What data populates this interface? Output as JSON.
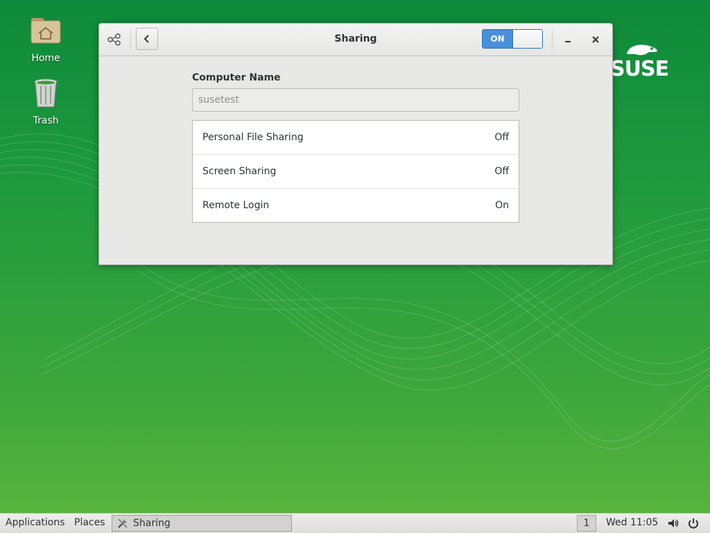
{
  "desktop": {
    "icons": [
      {
        "label": "Home",
        "icon": "home-folder-icon"
      },
      {
        "label": "Trash",
        "icon": "trash-icon"
      }
    ],
    "brand": "SUSE"
  },
  "window": {
    "title": "Sharing",
    "toggle_label": "ON",
    "computer_name": {
      "label": "Computer Name",
      "value": "susetest"
    },
    "services": [
      {
        "name": "Personal File Sharing",
        "status": "Off"
      },
      {
        "name": "Screen Sharing",
        "status": "Off"
      },
      {
        "name": "Remote Login",
        "status": "On"
      }
    ]
  },
  "taskbar": {
    "applications": "Applications",
    "places": "Places",
    "task": "Sharing",
    "workspace": "1",
    "clock": "Wed 11:05"
  },
  "colors": {
    "accent": "#4a90d9",
    "desktop_green": "#1f9a3e"
  }
}
